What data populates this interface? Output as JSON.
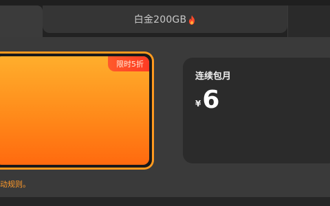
{
  "tabs": {
    "active_label": "",
    "platinum_label": "白金200GB"
  },
  "selected_plan": {
    "badge": "限时5折"
  },
  "plan_card": {
    "name": "连续包月",
    "currency": "¥",
    "price": "6"
  },
  "footer": {
    "rules_text": "动规则。"
  },
  "colors": {
    "accent_orange": "#ff9a1f",
    "badge_red": "#ff3b24",
    "background": "#3a3a3a"
  },
  "icons": {
    "tab_icon": "flame-icon"
  }
}
